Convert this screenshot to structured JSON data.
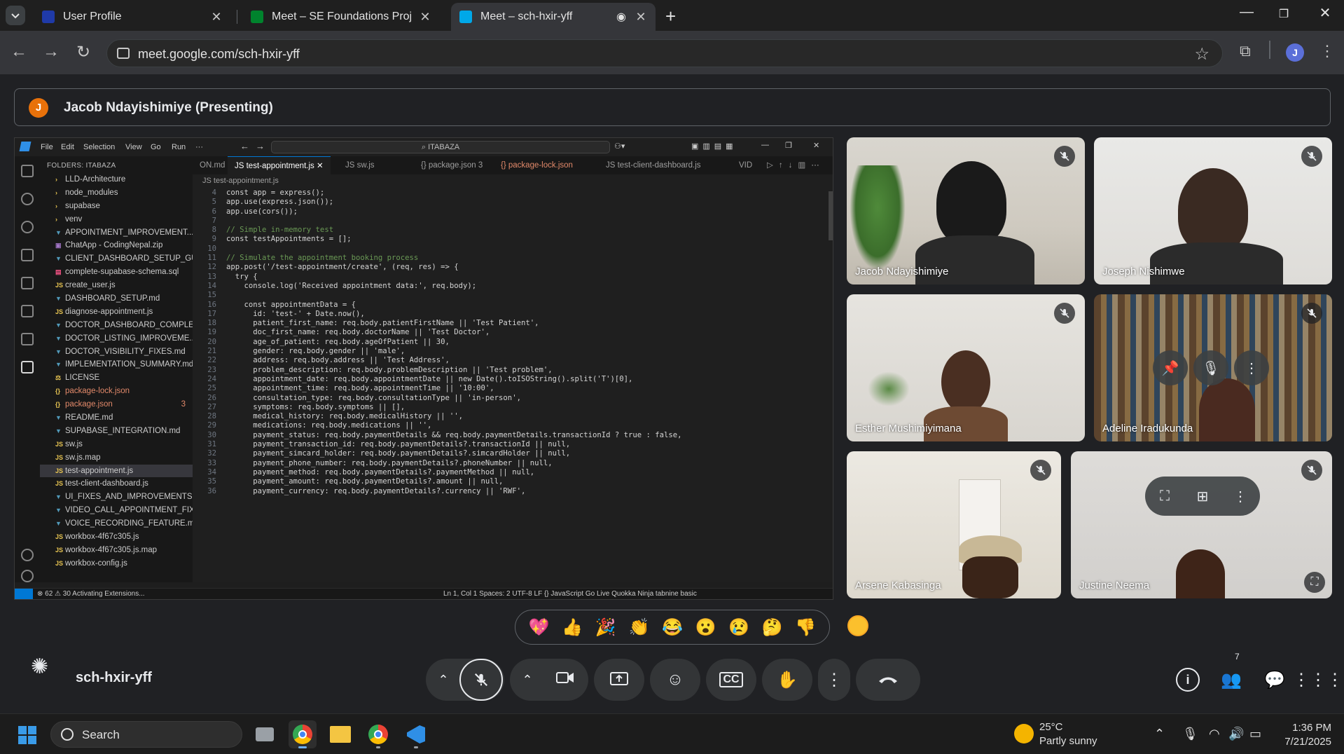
{
  "browser": {
    "tabs": [
      {
        "label": "User Profile",
        "favicon_color": "#1f3aa8"
      },
      {
        "label": "Meet – SE Foundations Proj",
        "favicon_color": "#00832d"
      },
      {
        "label": "Meet – sch-hxir-yff",
        "favicon_color": "#00a8e8"
      }
    ],
    "url": "meet.google.com/sch-hxir-yff",
    "profile_initial": "J"
  },
  "meet": {
    "presenter_initial": "J",
    "presenting_label": "Jacob Ndayishimiye (Presenting)",
    "meeting_code": "sch-hxir-yff",
    "participants_count": "7",
    "participants": [
      {
        "name": "Jacob Ndayishimiye",
        "muted": true
      },
      {
        "name": "Joseph Nishimwe",
        "muted": true
      },
      {
        "name": "Esther Mushimiyimana",
        "muted": true
      },
      {
        "name": "Adeline Iradukunda",
        "muted": true
      },
      {
        "name": "Arsene Kabasinga",
        "muted": true
      },
      {
        "name": "Justine Neema",
        "muted": true
      }
    ],
    "reactions": [
      "💖",
      "👍",
      "🎉",
      "👏",
      "😂",
      "😮",
      "😢",
      "🤔",
      "👎"
    ]
  },
  "vscode": {
    "menu": [
      "File",
      "Edit",
      "Selection",
      "View",
      "Go",
      "Run",
      "···"
    ],
    "command_center": "ITABAZA",
    "explorer_header": "FOLDERS: ITABAZA",
    "files": [
      {
        "name": "LLD-Architecture",
        "icon": "›"
      },
      {
        "name": "node_modules",
        "icon": "›"
      },
      {
        "name": "supabase",
        "icon": "›"
      },
      {
        "name": "venv",
        "icon": "›"
      },
      {
        "name": "APPOINTMENT_IMPROVEMENT...",
        "icon": "▼"
      },
      {
        "name": "ChatApp - CodingNepal.zip",
        "icon": "▣"
      },
      {
        "name": "CLIENT_DASHBOARD_SETUP_GU...",
        "icon": "▼"
      },
      {
        "name": "complete-supabase-schema.sql",
        "icon": "▤"
      },
      {
        "name": "create_user.js",
        "icon": "JS"
      },
      {
        "name": "DASHBOARD_SETUP.md",
        "icon": "▼"
      },
      {
        "name": "diagnose-appointment.js",
        "icon": "JS"
      },
      {
        "name": "DOCTOR_DASHBOARD_COMPLE...",
        "icon": "▼"
      },
      {
        "name": "DOCTOR_LISTING_IMPROVEME...",
        "icon": "▼"
      },
      {
        "name": "DOCTOR_VISIBILITY_FIXES.md",
        "icon": "▼"
      },
      {
        "name": "IMPLEMENTATION_SUMMARY.md",
        "icon": "▼"
      },
      {
        "name": "LICENSE",
        "icon": "⚖"
      },
      {
        "name": "package-lock.json",
        "icon": "{}"
      },
      {
        "name": "package.json",
        "icon": "{}"
      },
      {
        "name": "README.md",
        "icon": "▼"
      },
      {
        "name": "SUPABASE_INTEGRATION.md",
        "icon": "▼"
      },
      {
        "name": "sw.js",
        "icon": "JS"
      },
      {
        "name": "sw.js.map",
        "icon": "JS"
      },
      {
        "name": "test-appointment.js",
        "icon": "JS"
      },
      {
        "name": "test-client-dashboard.js",
        "icon": "JS"
      },
      {
        "name": "UI_FIXES_AND_IMPROVEMENTS...",
        "icon": "▼"
      },
      {
        "name": "VIDEO_CALL_APPOINTMENT_FIX...",
        "icon": "▼"
      },
      {
        "name": "VOICE_RECORDING_FEATURE.md",
        "icon": "▼"
      },
      {
        "name": "workbox-4f67c305.js",
        "icon": "JS"
      },
      {
        "name": "workbox-4f67c305.js.map",
        "icon": "JS"
      },
      {
        "name": "workbox-config.js",
        "icon": "JS"
      }
    ],
    "package_json_badge": "3",
    "editor_tabs": [
      {
        "label": "ON.md"
      },
      {
        "label": "JS  test-appointment.js  ✕"
      },
      {
        "label": "JS  sw.js"
      },
      {
        "label": "{}  package.json 3"
      },
      {
        "label": "{}  package-lock.json"
      },
      {
        "label": "JS  test-client-dashboard.js"
      },
      {
        "label": "VID"
      }
    ],
    "breadcrumb": "JS  test-appointment.js",
    "code": [
      {
        "n": "4",
        "text": "const app = express();"
      },
      {
        "n": "5",
        "text": "app.use(express.json());"
      },
      {
        "n": "6",
        "text": "app.use(cors());"
      },
      {
        "n": "7",
        "text": ""
      },
      {
        "n": "8",
        "text": "// Simple in-memory test"
      },
      {
        "n": "9",
        "text": "const testAppointments = [];"
      },
      {
        "n": "10",
        "text": ""
      },
      {
        "n": "11",
        "text": "// Simulate the appointment booking process"
      },
      {
        "n": "12",
        "text": "app.post('/test-appointment/create', (req, res) => {"
      },
      {
        "n": "13",
        "text": "  try {"
      },
      {
        "n": "14",
        "text": "    console.log('Received appointment data:', req.body);"
      },
      {
        "n": "15",
        "text": ""
      },
      {
        "n": "16",
        "text": "    const appointmentData = {"
      },
      {
        "n": "17",
        "text": "      id: 'test-' + Date.now(),"
      },
      {
        "n": "18",
        "text": "      patient_first_name: req.body.patientFirstName || 'Test Patient',"
      },
      {
        "n": "19",
        "text": "      doc_first_name: req.body.doctorName || 'Test Doctor',"
      },
      {
        "n": "20",
        "text": "      age_of_patient: req.body.ageOfPatient || 30,"
      },
      {
        "n": "21",
        "text": "      gender: req.body.gender || 'male',"
      },
      {
        "n": "22",
        "text": "      address: req.body.address || 'Test Address',"
      },
      {
        "n": "23",
        "text": "      problem_description: req.body.problemDescription || 'Test problem',"
      },
      {
        "n": "24",
        "text": "      appointment_date: req.body.appointmentDate || new Date().toISOString().split('T')[0],"
      },
      {
        "n": "25",
        "text": "      appointment_time: req.body.appointmentTime || '10:00',"
      },
      {
        "n": "26",
        "text": "      consultation_type: req.body.consultationType || 'in-person',"
      },
      {
        "n": "27",
        "text": "      symptoms: req.body.symptoms || [],"
      },
      {
        "n": "28",
        "text": "      medical_history: req.body.medicalHistory || '',"
      },
      {
        "n": "29",
        "text": "      medications: req.body.medications || '',"
      },
      {
        "n": "30",
        "text": "      payment_status: req.body.paymentDetails && req.body.paymentDetails.transactionId ? true : false,"
      },
      {
        "n": "31",
        "text": "      payment_transaction_id: req.body.paymentDetails?.transactionId || null,"
      },
      {
        "n": "32",
        "text": "      payment_simcard_holder: req.body.paymentDetails?.simcardHolder || null,"
      },
      {
        "n": "33",
        "text": "      payment_phone_number: req.body.paymentDetails?.phoneNumber || null,"
      },
      {
        "n": "34",
        "text": "      payment_method: req.body.paymentDetails?.paymentMethod || null,"
      },
      {
        "n": "35",
        "text": "      payment_amount: req.body.paymentDetails?.amount || null,"
      },
      {
        "n": "36",
        "text": "      payment_currency: req.body.paymentDetails?.currency || 'RWF',"
      }
    ],
    "status_left": "⊗ 62 ⚠ 30   Activating Extensions...",
    "status_right": "Ln 1, Col 1   Spaces: 2   UTF-8   LF   {} JavaScript   Go Live   Quokka   Ninja   tabnine basic"
  },
  "taskbar": {
    "search_label": "Search",
    "weather_temp": "25°C",
    "weather_desc": "Partly sunny",
    "time": "1:36 PM",
    "date": "7/21/2025"
  }
}
